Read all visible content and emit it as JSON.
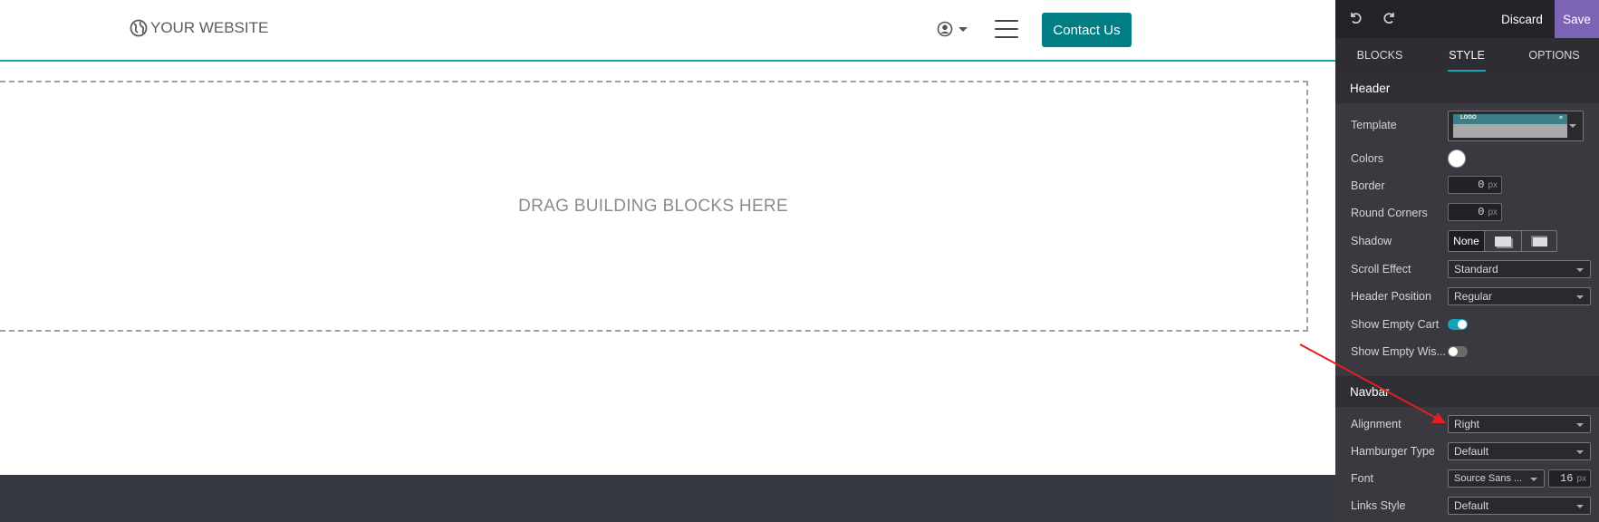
{
  "site": {
    "brand": "YOUR WEBSITE",
    "contact_button": "Contact Us",
    "drop_zone_text": "DRAG BUILDING BLOCKS HERE"
  },
  "editor": {
    "discard": "Discard",
    "save": "Save",
    "tabs": [
      "BLOCKS",
      "STYLE",
      "OPTIONS"
    ],
    "active_tab": "STYLE",
    "header_section": {
      "title": "Header",
      "template_label": "Template",
      "template_preview_logo": "LOGO",
      "colors_label": "Colors",
      "border_label": "Border",
      "border_value": "0",
      "round_corners_label": "Round Corners",
      "round_corners_value": "0",
      "unit_px": "px",
      "shadow_label": "Shadow",
      "shadow_none": "None",
      "scroll_effect_label": "Scroll Effect",
      "scroll_effect_value": "Standard",
      "header_position_label": "Header Position",
      "header_position_value": "Regular",
      "show_empty_cart_label": "Show Empty Cart",
      "show_empty_cart_on": true,
      "show_empty_wishlist_label": "Show Empty Wis...",
      "show_empty_wishlist_on": false
    },
    "navbar_section": {
      "title": "Navbar",
      "alignment_label": "Alignment",
      "alignment_value": "Right",
      "hamburger_type_label": "Hamburger Type",
      "hamburger_type_value": "Default",
      "font_label": "Font",
      "font_value": "Source Sans ...",
      "font_size_value": "16",
      "font_size_unit": "px",
      "links_style_label": "Links Style",
      "links_style_value": "Default"
    }
  },
  "colors": {
    "accent": "#17a2b8",
    "primary_button": "#017e84",
    "save_button": "#7b64b3",
    "panel_bg": "#3a3940",
    "footer_bg": "#343a40",
    "annotation_arrow": "#e02020"
  }
}
